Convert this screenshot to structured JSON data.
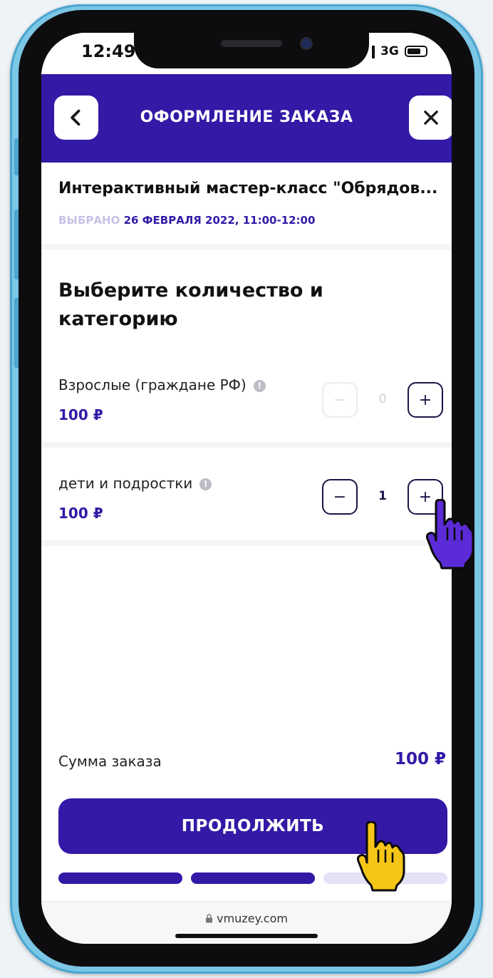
{
  "status": {
    "time": "12:49",
    "network": "3G"
  },
  "header": {
    "title": "ОФОРМЛЕНИЕ ЗАКАЗА",
    "back_icon": "chevron-left-icon",
    "close_icon": "close-icon"
  },
  "event": {
    "title": "Интерактивный мастер-класс \"Обрядов...",
    "date_label": "ВЫБРАНО",
    "date_value": "26 ФЕВРАЛЯ 2022, 11:00-12:00"
  },
  "section_title": "Выберите количество и категорию",
  "tickets": [
    {
      "name": "Взрослые (граждане РФ)",
      "price": "100 ₽",
      "count": "0",
      "minus": "−",
      "plus": "+"
    },
    {
      "name": "дети и подростки",
      "price": "100 ₽",
      "count": "1",
      "minus": "−",
      "plus": "+"
    }
  ],
  "info_glyph": "!",
  "summary": {
    "label": "Сумма заказа",
    "value": "100 ₽"
  },
  "continue_label": "ПРОДОЛЖИТЬ",
  "progress": {
    "steps_total": 3,
    "steps_done": 2
  },
  "browser": {
    "url": "vmuzey.com",
    "lock_icon": "lock-icon"
  },
  "colors": {
    "brand": "#3319a6",
    "progress_inactive": "#e5e1f7",
    "frame": "#7cc6e6",
    "cursor_purple": "#5a2bd6",
    "cursor_yellow": "#f5c518"
  }
}
